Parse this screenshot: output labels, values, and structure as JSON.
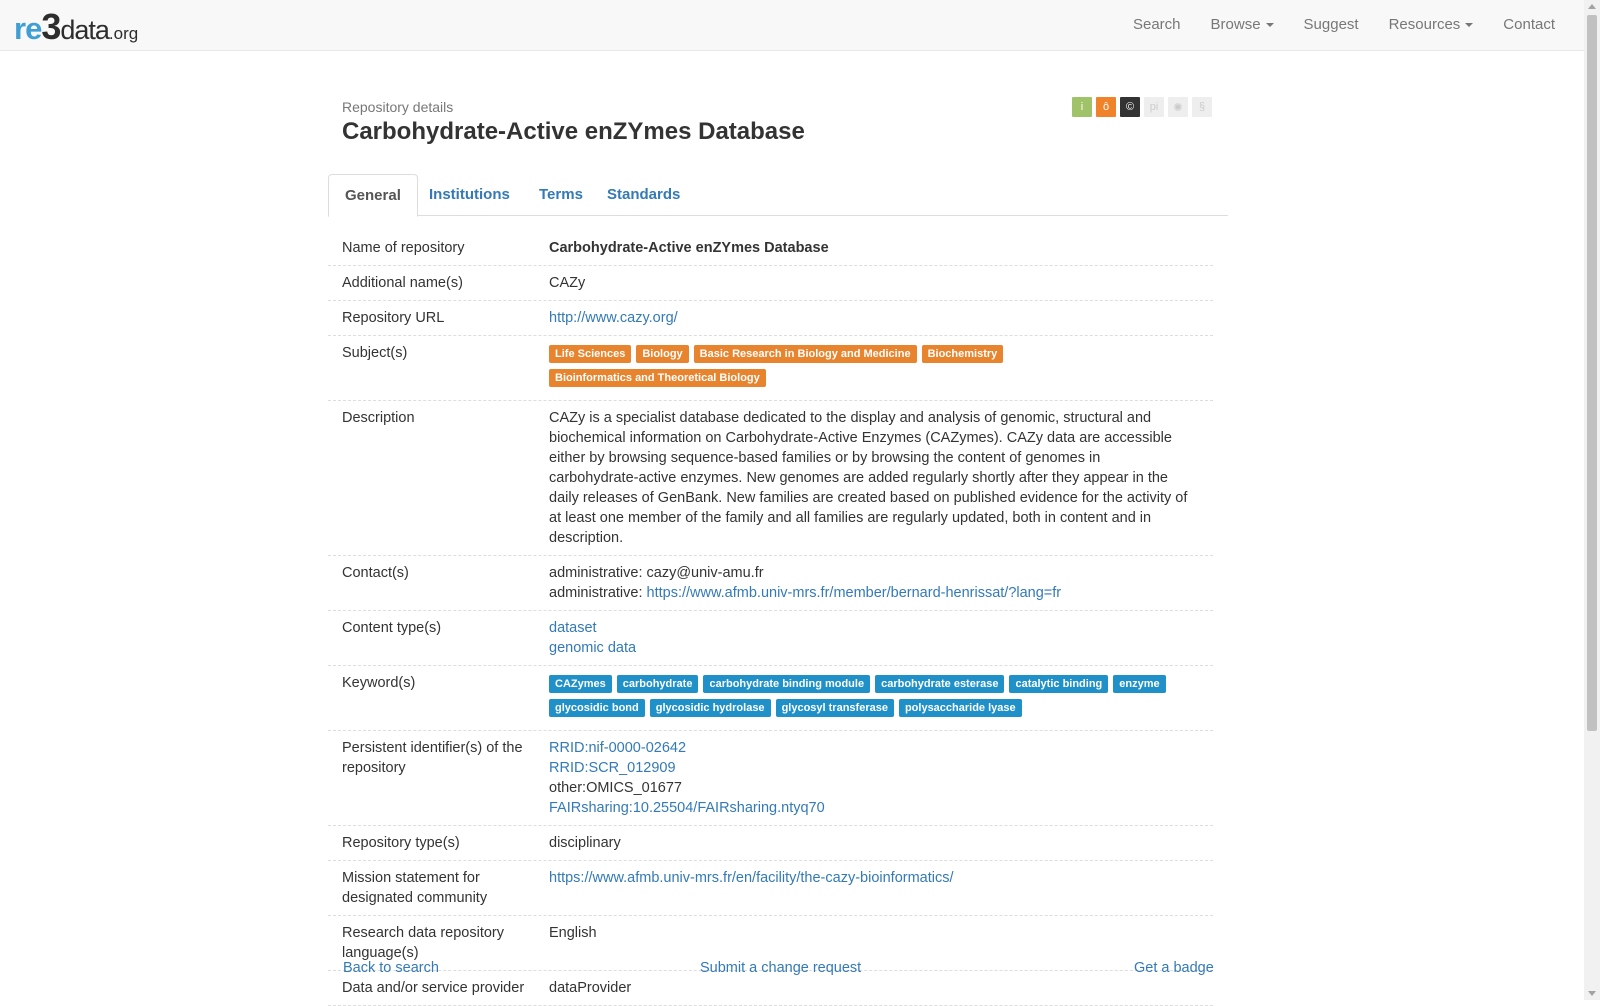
{
  "brand": {
    "re": "re",
    "three": "3",
    "data": "data",
    "org": ".org"
  },
  "nav": {
    "search": "Search",
    "browse": "Browse",
    "suggest": "Suggest",
    "resources": "Resources",
    "contact": "Contact"
  },
  "header": {
    "crumb": "Repository details",
    "title": "Carbohydrate-Active enZYmes Database"
  },
  "badges": [
    {
      "icon": "info-icon",
      "glyph": "i",
      "color": "#a0c36a"
    },
    {
      "icon": "open-access-icon",
      "glyph": "ô",
      "color": "#f0822a"
    },
    {
      "icon": "copyright-icon",
      "glyph": "©",
      "color": "#333333"
    },
    {
      "icon": "persistent-id-icon",
      "glyph": "pi",
      "color": "#eeeeee"
    },
    {
      "icon": "certificate-icon",
      "glyph": "✺",
      "color": "#eeeeee"
    },
    {
      "icon": "policy-icon",
      "glyph": "§",
      "color": "#eeeeee"
    }
  ],
  "tabs": {
    "general": "General",
    "institutions": "Institutions",
    "terms": "Terms",
    "standards": "Standards"
  },
  "details": {
    "name": {
      "label": "Name of repository",
      "value": "Carbohydrate-Active enZYmes Database"
    },
    "additional": {
      "label": "Additional name(s)",
      "value": "CAZy"
    },
    "url": {
      "label": "Repository URL",
      "value": "http://www.cazy.org/"
    },
    "subjects": {
      "label": "Subject(s)",
      "tags": [
        "Life Sciences",
        "Biology",
        "Basic Research in Biology and Medicine",
        "Biochemistry",
        "Bioinformatics and Theoretical Biology"
      ]
    },
    "description": {
      "label": "Description",
      "value": "CAZy is a specialist database dedicated to the display and analysis of genomic, structural and biochemical information on Carbohydrate-Active Enzymes (CAZymes). CAZy data are accessible either by browsing sequence-based families or by browsing the content of genomes in carbohydrate-active enzymes. New genomes are added regularly shortly after they appear in the daily releases of GenBank. New families are created based on published evidence for the activity of at least one member of the family and all families are regularly updated, both in content and in description."
    },
    "contacts": {
      "label": "Contact(s)",
      "line1": "administrative: cazy@univ-amu.fr",
      "line2_prefix": "administrative: ",
      "line2_link": "https://www.afmb.univ-mrs.fr/member/bernard-henrissat/?lang=fr"
    },
    "content_types": {
      "label": "Content type(s)",
      "items": [
        "dataset",
        "genomic data"
      ]
    },
    "keywords": {
      "label": "Keyword(s)",
      "tags": [
        "CAZymes",
        "carbohydrate",
        "carbohydrate binding module",
        "carbohydrate esterase",
        "catalytic binding",
        "enzyme",
        "glycosidic bond",
        "glycosidic hydrolase",
        "glycosyl transferase",
        "polysaccharide lyase"
      ]
    },
    "pids": {
      "label": "Persistent identifier(s) of the repository",
      "items": [
        "RRID:nif-0000-02642",
        "RRID:SCR_012909",
        "other:OMICS_01677",
        "FAIRsharing:10.25504/FAIRsharing.ntyq70"
      ]
    },
    "repo_type": {
      "label": "Repository type(s)",
      "value": "disciplinary"
    },
    "mission": {
      "label": "Mission statement for designated community",
      "value": "https://www.afmb.univ-mrs.fr/en/facility/the-cazy-bioinformatics/"
    },
    "language": {
      "label": "Research data repository language(s)",
      "value": "English"
    },
    "provider": {
      "label": "Data and/or service provider",
      "value": "dataProvider"
    }
  },
  "footer": {
    "back": "Back to search",
    "change": "Submit a change request",
    "badge": "Get a badge"
  }
}
